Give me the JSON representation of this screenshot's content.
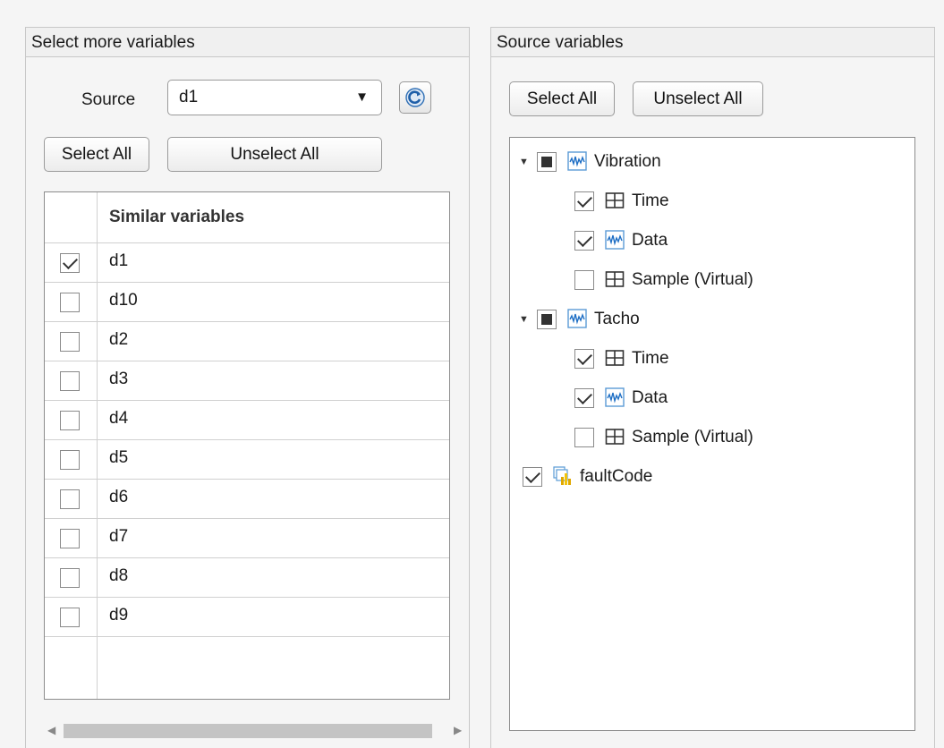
{
  "left_panel": {
    "title": "Select more variables",
    "source_label": "Source",
    "source_value": "d1",
    "select_all": "Select All",
    "unselect_all": "Unselect All",
    "table": {
      "header": "Similar variables",
      "rows": [
        {
          "name": "d1",
          "checked": true
        },
        {
          "name": "d10",
          "checked": false
        },
        {
          "name": "d2",
          "checked": false
        },
        {
          "name": "d3",
          "checked": false
        },
        {
          "name": "d4",
          "checked": false
        },
        {
          "name": "d5",
          "checked": false
        },
        {
          "name": "d6",
          "checked": false
        },
        {
          "name": "d7",
          "checked": false
        },
        {
          "name": "d8",
          "checked": false
        },
        {
          "name": "d9",
          "checked": false
        }
      ]
    }
  },
  "right_panel": {
    "title": "Source variables",
    "select_all": "Select All",
    "unselect_all": "Unselect All",
    "tree": [
      {
        "label": "Vibration",
        "state": "partial",
        "icon": "signal-icon",
        "expanded": true,
        "children": [
          {
            "label": "Time",
            "checked": true,
            "icon": "table-icon"
          },
          {
            "label": "Data",
            "checked": true,
            "icon": "signal-icon"
          },
          {
            "label": "Sample (Virtual)",
            "checked": false,
            "icon": "table-icon"
          }
        ]
      },
      {
        "label": "Tacho",
        "state": "partial",
        "icon": "signal-icon",
        "expanded": true,
        "children": [
          {
            "label": "Time",
            "checked": true,
            "icon": "table-icon"
          },
          {
            "label": "Data",
            "checked": true,
            "icon": "signal-icon"
          },
          {
            "label": "Sample (Virtual)",
            "checked": false,
            "icon": "table-icon"
          }
        ]
      },
      {
        "label": "faultCode",
        "state": "checked",
        "icon": "categorical-icon"
      }
    ]
  }
}
